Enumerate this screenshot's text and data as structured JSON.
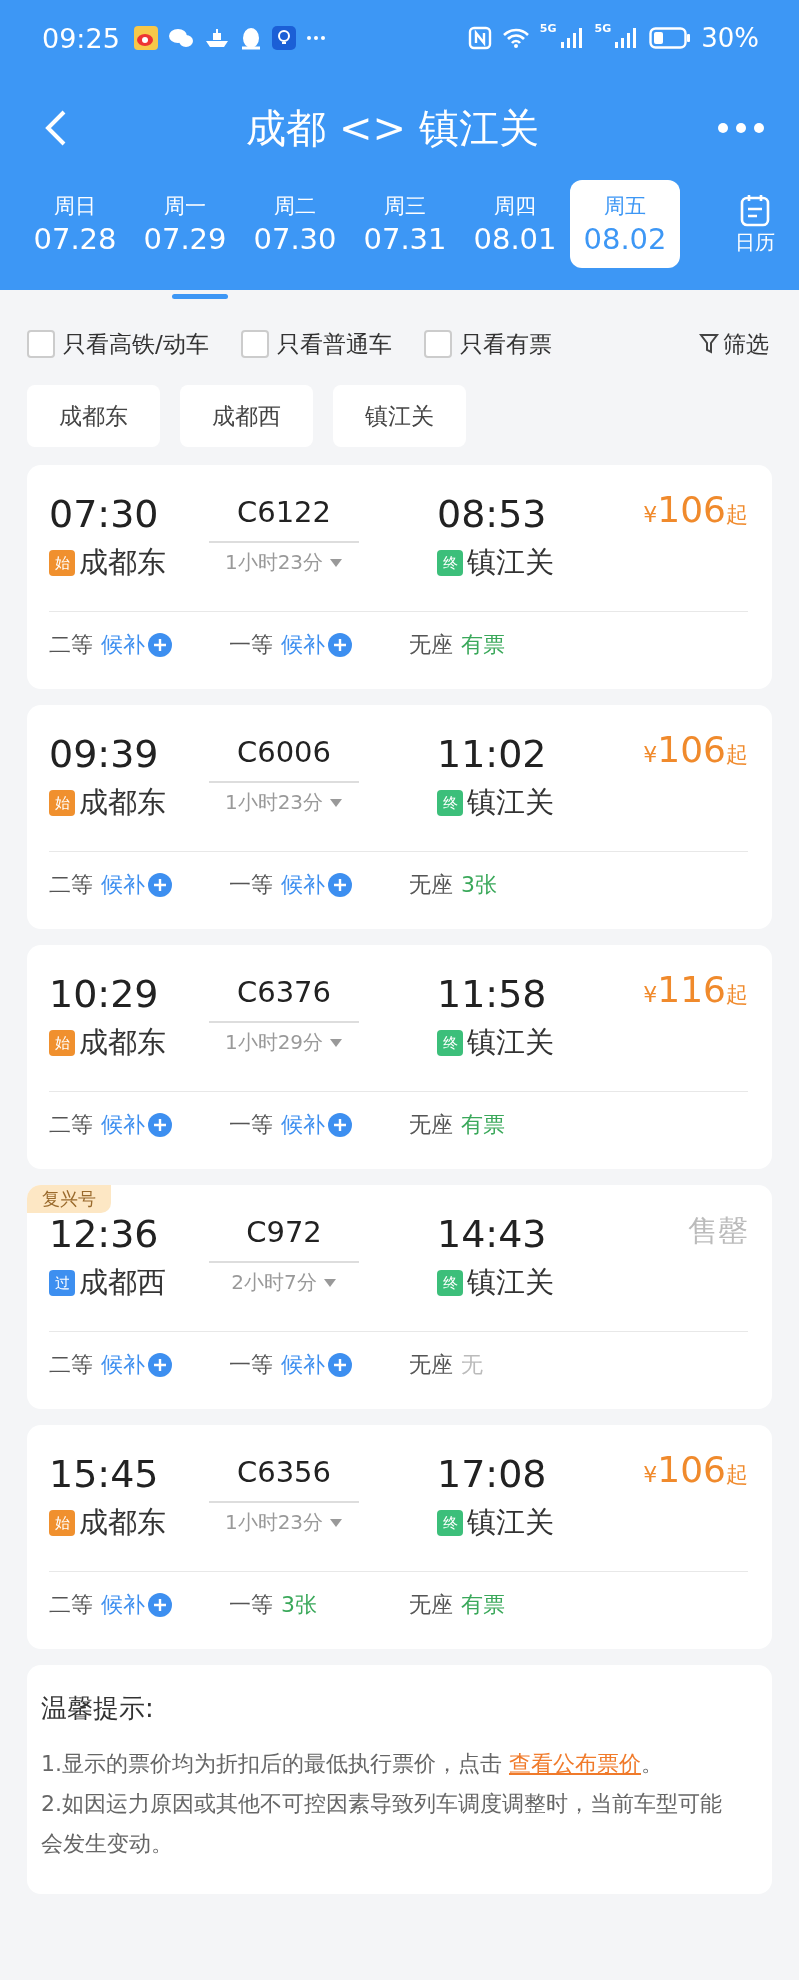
{
  "status_bar": {
    "time": "09:25",
    "signal_labels": [
      "5G",
      "5G"
    ],
    "battery": "30%"
  },
  "header": {
    "title": "成都 <> 镇江关"
  },
  "dates": [
    {
      "weekday": "周日",
      "date": "07.28",
      "selected": false
    },
    {
      "weekday": "周一",
      "date": "07.29",
      "selected": false
    },
    {
      "weekday": "周二",
      "date": "07.30",
      "selected": false
    },
    {
      "weekday": "周三",
      "date": "07.31",
      "selected": false
    },
    {
      "weekday": "周四",
      "date": "08.01",
      "selected": false
    },
    {
      "weekday": "周五",
      "date": "08.02",
      "selected": true
    }
  ],
  "calendar": {
    "label": "日历"
  },
  "filters": [
    {
      "label": "只看高铁/动车",
      "checked": false
    },
    {
      "label": "只看普通车",
      "checked": false
    },
    {
      "label": "只看有票",
      "checked": false
    }
  ],
  "filter_button": "筛选",
  "station_chips": [
    "成都东",
    "成都西",
    "镇江关"
  ],
  "trains": [
    {
      "depart_time": "07:30",
      "train_no": "C6122",
      "arrive_time": "08:53",
      "price": {
        "kind": "price",
        "currency": "¥",
        "amount": "106",
        "suffix": "起"
      },
      "origin_badge": {
        "text": "始",
        "color": "#f0902e"
      },
      "origin": "成都东",
      "duration": "1小时23分",
      "dest_badge": {
        "text": "终",
        "color": "#3cbf7a"
      },
      "dest": "镇江关",
      "seats": [
        {
          "class": "二等",
          "status": "候补",
          "kind": "waitlist"
        },
        {
          "class": "一等",
          "status": "候补",
          "kind": "waitlist"
        },
        {
          "class": "无座",
          "status": "有票",
          "kind": "available"
        }
      ]
    },
    {
      "depart_time": "09:39",
      "train_no": "C6006",
      "arrive_time": "11:02",
      "price": {
        "kind": "price",
        "currency": "¥",
        "amount": "106",
        "suffix": "起"
      },
      "origin_badge": {
        "text": "始",
        "color": "#f0902e"
      },
      "origin": "成都东",
      "duration": "1小时23分",
      "dest_badge": {
        "text": "终",
        "color": "#3cbf7a"
      },
      "dest": "镇江关",
      "seats": [
        {
          "class": "二等",
          "status": "候补",
          "kind": "waitlist"
        },
        {
          "class": "一等",
          "status": "候补",
          "kind": "waitlist"
        },
        {
          "class": "无座",
          "status": "3张",
          "kind": "available"
        }
      ]
    },
    {
      "depart_time": "10:29",
      "train_no": "C6376",
      "arrive_time": "11:58",
      "price": {
        "kind": "price",
        "currency": "¥",
        "amount": "116",
        "suffix": "起"
      },
      "origin_badge": {
        "text": "始",
        "color": "#f0902e"
      },
      "origin": "成都东",
      "duration": "1小时29分",
      "dest_badge": {
        "text": "终",
        "color": "#3cbf7a"
      },
      "dest": "镇江关",
      "seats": [
        {
          "class": "二等",
          "status": "候补",
          "kind": "waitlist"
        },
        {
          "class": "一等",
          "status": "候补",
          "kind": "waitlist"
        },
        {
          "class": "无座",
          "status": "有票",
          "kind": "available"
        }
      ]
    },
    {
      "tag": "复兴号",
      "depart_time": "12:36",
      "train_no": "C972",
      "arrive_time": "14:43",
      "price": {
        "kind": "soldout",
        "text": "售罄"
      },
      "origin_badge": {
        "text": "过",
        "color": "#3d8ff0"
      },
      "origin": "成都西",
      "duration": "2小时7分",
      "dest_badge": {
        "text": "终",
        "color": "#3cbf7a"
      },
      "dest": "镇江关",
      "seats": [
        {
          "class": "二等",
          "status": "候补",
          "kind": "waitlist"
        },
        {
          "class": "一等",
          "status": "候补",
          "kind": "waitlist"
        },
        {
          "class": "无座",
          "status": "无",
          "kind": "none"
        }
      ]
    },
    {
      "depart_time": "15:45",
      "train_no": "C6356",
      "arrive_time": "17:08",
      "price": {
        "kind": "price",
        "currency": "¥",
        "amount": "106",
        "suffix": "起"
      },
      "origin_badge": {
        "text": "始",
        "color": "#f0902e"
      },
      "origin": "成都东",
      "duration": "1小时23分",
      "dest_badge": {
        "text": "终",
        "color": "#3cbf7a"
      },
      "dest": "镇江关",
      "seats": [
        {
          "class": "二等",
          "status": "候补",
          "kind": "waitlist"
        },
        {
          "class": "一等",
          "status": "3张",
          "kind": "available"
        },
        {
          "class": "无座",
          "status": "有票",
          "kind": "available"
        }
      ]
    }
  ],
  "notice": {
    "title": "温馨提示:",
    "item_1": {
      "text": "1.显示的票价均为折扣后的最低执行票价，点击",
      "link": "查看公布票价",
      "after": "。"
    },
    "item_2": "2.如因运力原因或其他不可控因素导致列车调度调整时，当前车型可能会发生变动。"
  }
}
